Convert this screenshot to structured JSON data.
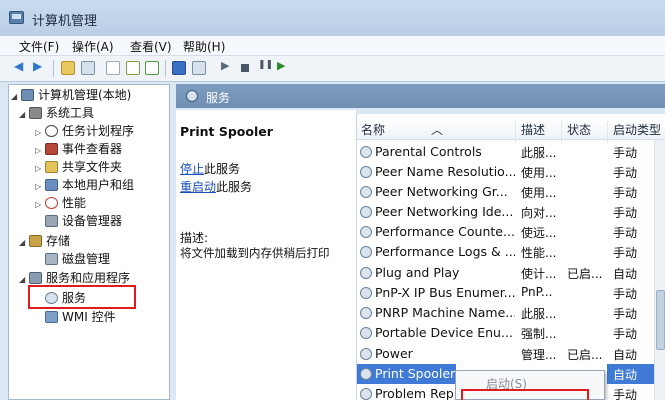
{
  "window": {
    "title": "计算机管理"
  },
  "menu": [
    "文件(F)",
    "操作(A)",
    "查看(V)",
    "帮助(H)"
  ],
  "toolbar": {
    "icons": [
      "back-icon",
      "forward-icon",
      "folder-icon",
      "panel-icon",
      "doc-icon",
      "refresh-icon",
      "export-icon",
      "help-icon",
      "panel2-icon",
      "play-icon",
      "stop-icon",
      "pause-icon",
      "restart-icon"
    ]
  },
  "tree": {
    "root": "计算机管理(本地)",
    "system_tools": "系统工具",
    "task_scheduler": "任务计划程序",
    "event_viewer": "事件查看器",
    "shared_folders": "共享文件夹",
    "local_users": "本地用户和组",
    "performance": "性能",
    "device_manager": "设备管理器",
    "storage": "存储",
    "disk_management": "磁盘管理",
    "services_apps": "服务和应用程序",
    "services": "服务",
    "wmi": "WMI 控件"
  },
  "right_header": {
    "label": "服务"
  },
  "detail": {
    "service_name": "Print Spooler",
    "stop_link": "停止",
    "stop_rest": "此服务",
    "restart_link": "重启动",
    "restart_rest": "此服务",
    "desc_label": "描述:",
    "desc_text": "将文件加载到内存供稍后打印"
  },
  "list": {
    "columns": [
      "名称",
      "描述",
      "状态",
      "启动类型"
    ],
    "rows": [
      {
        "name": "Parental Controls",
        "desc": "此服...",
        "status": "",
        "startup": "手动"
      },
      {
        "name": "Peer Name Resolutio...",
        "desc": "使用...",
        "status": "",
        "startup": "手动"
      },
      {
        "name": "Peer Networking Gr...",
        "desc": "使用...",
        "status": "",
        "startup": "手动"
      },
      {
        "name": "Peer Networking Ide...",
        "desc": "向对...",
        "status": "",
        "startup": "手动"
      },
      {
        "name": "Performance Counte...",
        "desc": "使远...",
        "status": "",
        "startup": "手动"
      },
      {
        "name": "Performance Logs & ...",
        "desc": "性能...",
        "status": "",
        "startup": "手动"
      },
      {
        "name": "Plug and Play",
        "desc": "使计...",
        "status": "已启...",
        "startup": "自动"
      },
      {
        "name": "PnP-X IP Bus Enumer...",
        "desc": "PnP...",
        "status": "",
        "startup": "手动"
      },
      {
        "name": "PNRP Machine Name...",
        "desc": "此服...",
        "status": "",
        "startup": "手动"
      },
      {
        "name": "Portable Device Enu...",
        "desc": "强制...",
        "status": "",
        "startup": "手动"
      },
      {
        "name": "Power",
        "desc": "管理...",
        "status": "已启...",
        "startup": "自动"
      },
      {
        "name": "Print Spooler",
        "desc": "",
        "status": "",
        "startup": "自动"
      },
      {
        "name": "Problem Rep",
        "desc": "",
        "status": "",
        "startup": "手动"
      }
    ]
  },
  "context_menu": {
    "item1": "启动(S)"
  }
}
